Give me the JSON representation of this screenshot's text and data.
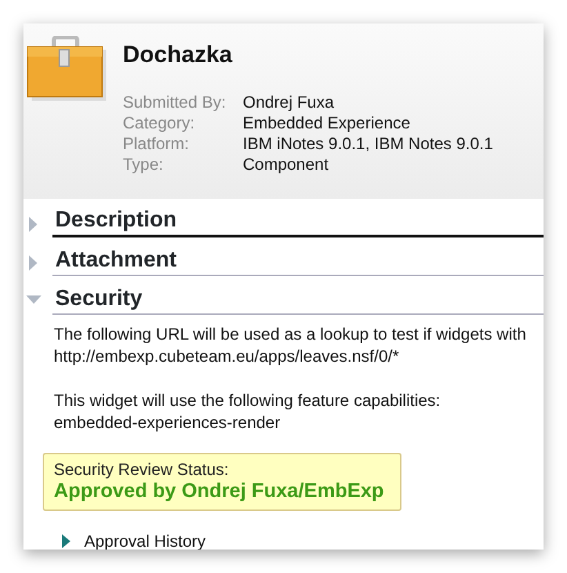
{
  "widget": {
    "title": "Dochazka",
    "details": [
      {
        "label": "Submitted By:",
        "value": "Ondrej Fuxa"
      },
      {
        "label": "Category:",
        "value": "Embedded Experience"
      },
      {
        "label": "Platform:",
        "value": "IBM iNotes 9.0.1, IBM Notes 9.0.1"
      },
      {
        "label": "Type:",
        "value": "Component"
      }
    ]
  },
  "sections": [
    {
      "title": "Description",
      "expanded": false
    },
    {
      "title": "Attachment",
      "expanded": false
    },
    {
      "title": "Security",
      "expanded": true
    }
  ],
  "security": {
    "paragraphs": [
      [
        "The following URL will be used as a lookup to test if widgets with",
        "http://embexp.cubeteam.eu/apps/leaves.nsf/0/*"
      ],
      [
        "This widget will use the following feature capabilities:",
        "embedded-experiences-render"
      ]
    ],
    "review_label": "Security Review Status:",
    "review_status": "Approved by Ondrej Fuxa/EmbExp",
    "history": {
      "label": "Approval History",
      "expanded": false
    }
  }
}
